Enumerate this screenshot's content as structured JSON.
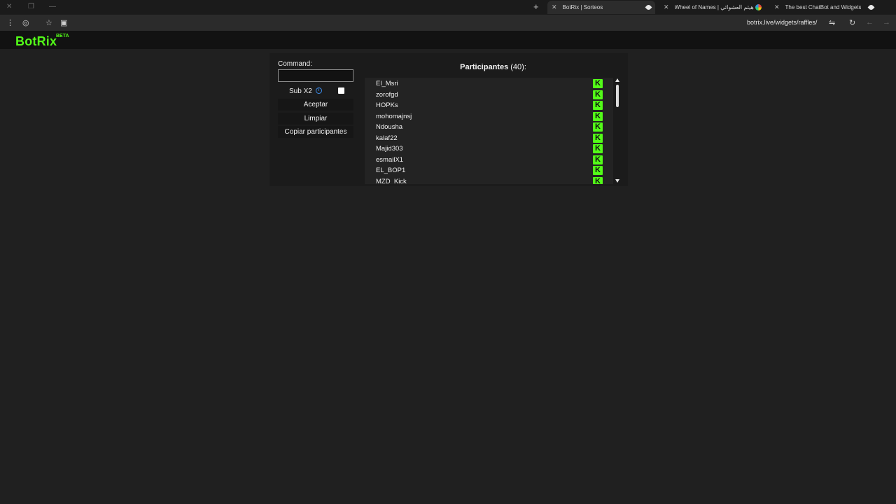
{
  "browser": {
    "tabs": [
      {
        "title": "BotRix | Sorteos",
        "active": true
      },
      {
        "title": "Wheel of Names | هيثم العشوائي",
        "active": false
      },
      {
        "title": "The best ChatBot and Widgets",
        "active": false
      }
    ],
    "url": "botrix.live/widgets/raffles/"
  },
  "header": {
    "logo": "BotRix",
    "badge": "BETA",
    "brand_color": "#53fc18"
  },
  "form": {
    "command_label": "Command:",
    "command_value": "",
    "sub_label": "Sub X2",
    "sub_checked": true,
    "accept_label": "Aceptar",
    "clear_label": "Limpiar",
    "copy_label": "Copiar participantes"
  },
  "participants": {
    "title": "Participantes",
    "count_text": "(40):",
    "items": [
      "El_Msri",
      "zorofgd",
      "HOPKs",
      "mohomajnsj",
      "Ndousha",
      "kalaf22",
      "Majid303",
      "esmailX1",
      "EL_BOP1",
      "MZD_Kick"
    ],
    "platform_icon": "kick-icon"
  }
}
